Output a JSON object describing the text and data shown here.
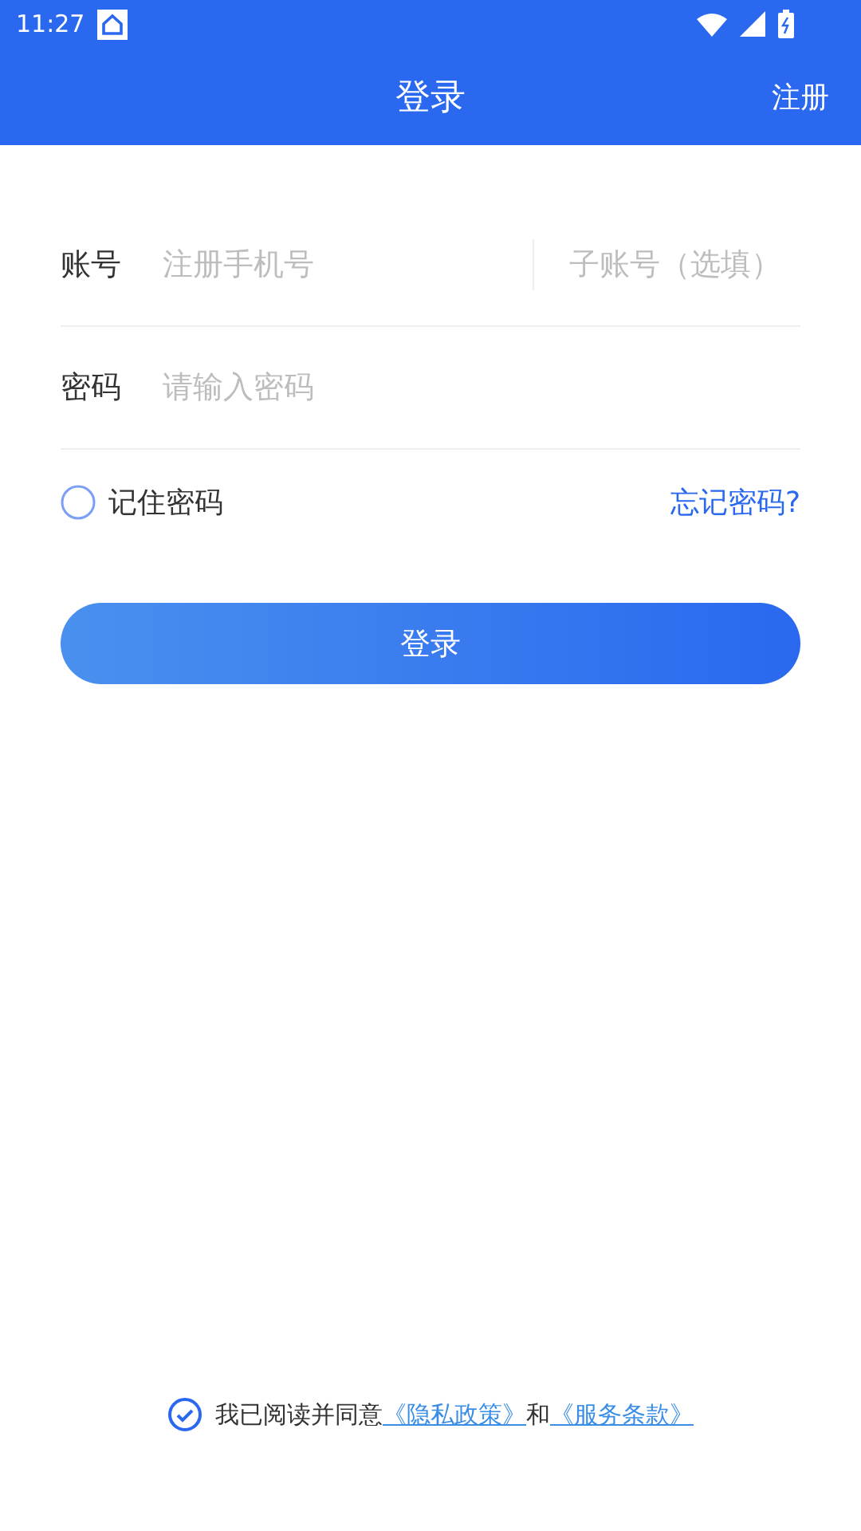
{
  "status_bar": {
    "time": "11:27"
  },
  "nav": {
    "title": "登录",
    "action": "注册"
  },
  "fields": [
    {
      "label": "账号",
      "placeholder": "注册手机号",
      "extra_placeholder": "子账号（选填）"
    },
    {
      "label": "密码",
      "placeholder": "请输入密码"
    }
  ],
  "remember": {
    "label": "记住密码",
    "checked": false
  },
  "forgot_link": "忘记密码?",
  "login_button": "登录",
  "agreement": {
    "checked": true,
    "text": "我已阅读并同意",
    "privacy_link": "《隐私政策》",
    "joiner": "和",
    "terms_link": "《服务条款》"
  }
}
